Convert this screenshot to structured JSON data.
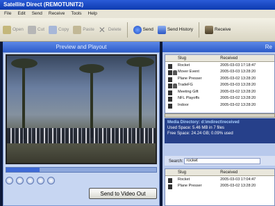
{
  "window": {
    "title": "Satellite Direct (REMOTUNIT2)"
  },
  "menu": [
    "File",
    "Edit",
    "Send",
    "Receive",
    "Tools",
    "Help"
  ],
  "toolbar": {
    "faded": [
      "Open",
      "Cut",
      "Copy",
      "Paste",
      "Delete"
    ],
    "send": "Send",
    "send_history": "Send History",
    "receive": "Receive"
  },
  "left": {
    "header": "Preview and Playout",
    "playback_progress": 0.22,
    "send_button": "Send to Video Out"
  },
  "right": {
    "header": "Re",
    "columns": {
      "slug": "Slug",
      "received": "Received"
    },
    "rows": [
      {
        "slug": "Rocket",
        "received": "2005-03-03 17:18:47",
        "lock": false
      },
      {
        "slug": "Mover Event",
        "received": "2005-03-03 13:28:20",
        "lock": true
      },
      {
        "slug": "Plane Presser",
        "received": "2005-03-02 13:28:20",
        "lock": false
      },
      {
        "slug": "TradeFG",
        "received": "2005-03-03 13:28:20",
        "lock": true
      },
      {
        "slug": "Meeting Gift",
        "received": "2005-03-02 13:28:20",
        "lock": false
      },
      {
        "slug": "NFL Playoffs",
        "received": "2005-03-02 13:28:20",
        "lock": false
      },
      {
        "slug": "Indoor",
        "received": "2005-03-02 13:28:20",
        "lock": false
      }
    ],
    "status": {
      "line1": "Media Directory: d:\\mdirect\\received",
      "line2": "Used Space: 5.46 MB in 7 files",
      "line3": "Free Space: 24.24 GB; 0.09% used"
    },
    "search": {
      "label": "Search:",
      "value": "rocket"
    },
    "results": [
      {
        "slug": "Rocket",
        "received": "2005-03-03 17:04:47"
      },
      {
        "slug": "Plane Presser",
        "received": "2005-03-02 13:28:20"
      }
    ]
  }
}
